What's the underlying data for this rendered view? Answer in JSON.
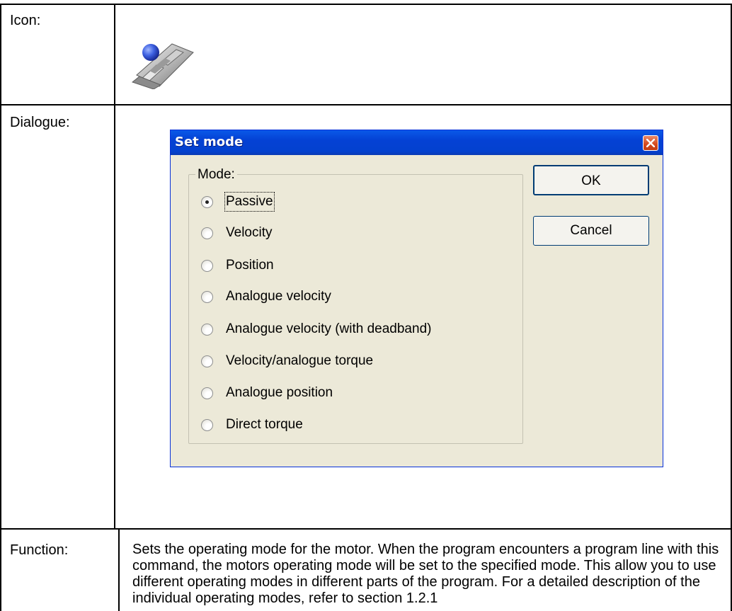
{
  "rows": {
    "icon_label": "Icon:",
    "dialogue_label": "Dialogue:",
    "function_label": "Function:",
    "function_text": "Sets the operating mode for the motor. When the program encounters a program line with this command, the motors operating mode will be set to the specified mode. This allow you to use different operating modes in different parts of the program. For a detailed description of the individual operating modes, refer to section 1.2.1"
  },
  "icon": {
    "name": "set-mode-icon"
  },
  "dialog": {
    "title": "Set mode",
    "group_label": "Mode:",
    "options": [
      {
        "label": "Passive",
        "selected": true
      },
      {
        "label": "Velocity",
        "selected": false
      },
      {
        "label": "Position",
        "selected": false
      },
      {
        "label": "Analogue velocity",
        "selected": false
      },
      {
        "label": "Analogue velocity (with deadband)",
        "selected": false
      },
      {
        "label": "Velocity/analogue torque",
        "selected": false
      },
      {
        "label": "Analogue position",
        "selected": false
      },
      {
        "label": "Direct torque",
        "selected": false
      }
    ],
    "ok_label": "OK",
    "cancel_label": "Cancel"
  },
  "colors": {
    "titlebar": "#0441d4",
    "dialog_bg": "#ece9d8",
    "close_button": "#d5481c"
  }
}
